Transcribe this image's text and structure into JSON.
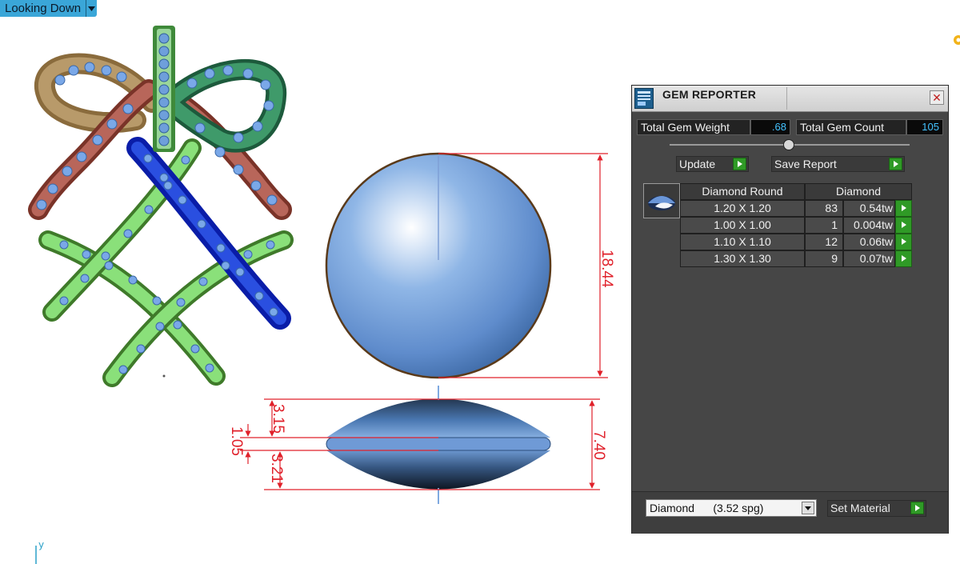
{
  "viewport": {
    "view_name": "Looking Down",
    "axis_label": "y",
    "dimensions": {
      "height_dim": "18.44",
      "top_dim": "3.15",
      "girdle_dim": "1.05",
      "bottom_dim": "3.21",
      "depth_dim": "7.40"
    }
  },
  "gem_reporter": {
    "title": "GEM REPORTER",
    "total_weight_label": "Total Gem Weight",
    "total_weight_value": ".68",
    "total_count_label": "Total Gem Count",
    "total_count_value": "105",
    "update_label": "Update",
    "save_report_label": "Save Report",
    "table": {
      "headers": [
        "Diamond Round",
        "Diamond"
      ],
      "rows": [
        {
          "size": "1.20 X 1.20",
          "count": "83",
          "weight": "0.54tw"
        },
        {
          "size": "1.00 X 1.00",
          "count": "1",
          "weight": "0.004tw"
        },
        {
          "size": "1.10 X 1.10",
          "count": "12",
          "weight": "0.06tw"
        },
        {
          "size": "1.30 X 1.30",
          "count": "9",
          "weight": "0.07tw"
        }
      ]
    },
    "material": "Diamond      (3.52 spg)",
    "set_material_label": "Set Material"
  },
  "colors": {
    "view_label_bg": "#3aa6d8",
    "dimension_red": "#e0202a",
    "gem_blue": "#6e9fdb",
    "accent_green": "#2f9a26",
    "value_cyan": "#43c2ff"
  },
  "icons": {
    "close": "close-icon",
    "action_arrow": "play-arrow-icon",
    "dropdown": "chevron-down-icon",
    "gem_thumbnail": "diamond-icon"
  }
}
